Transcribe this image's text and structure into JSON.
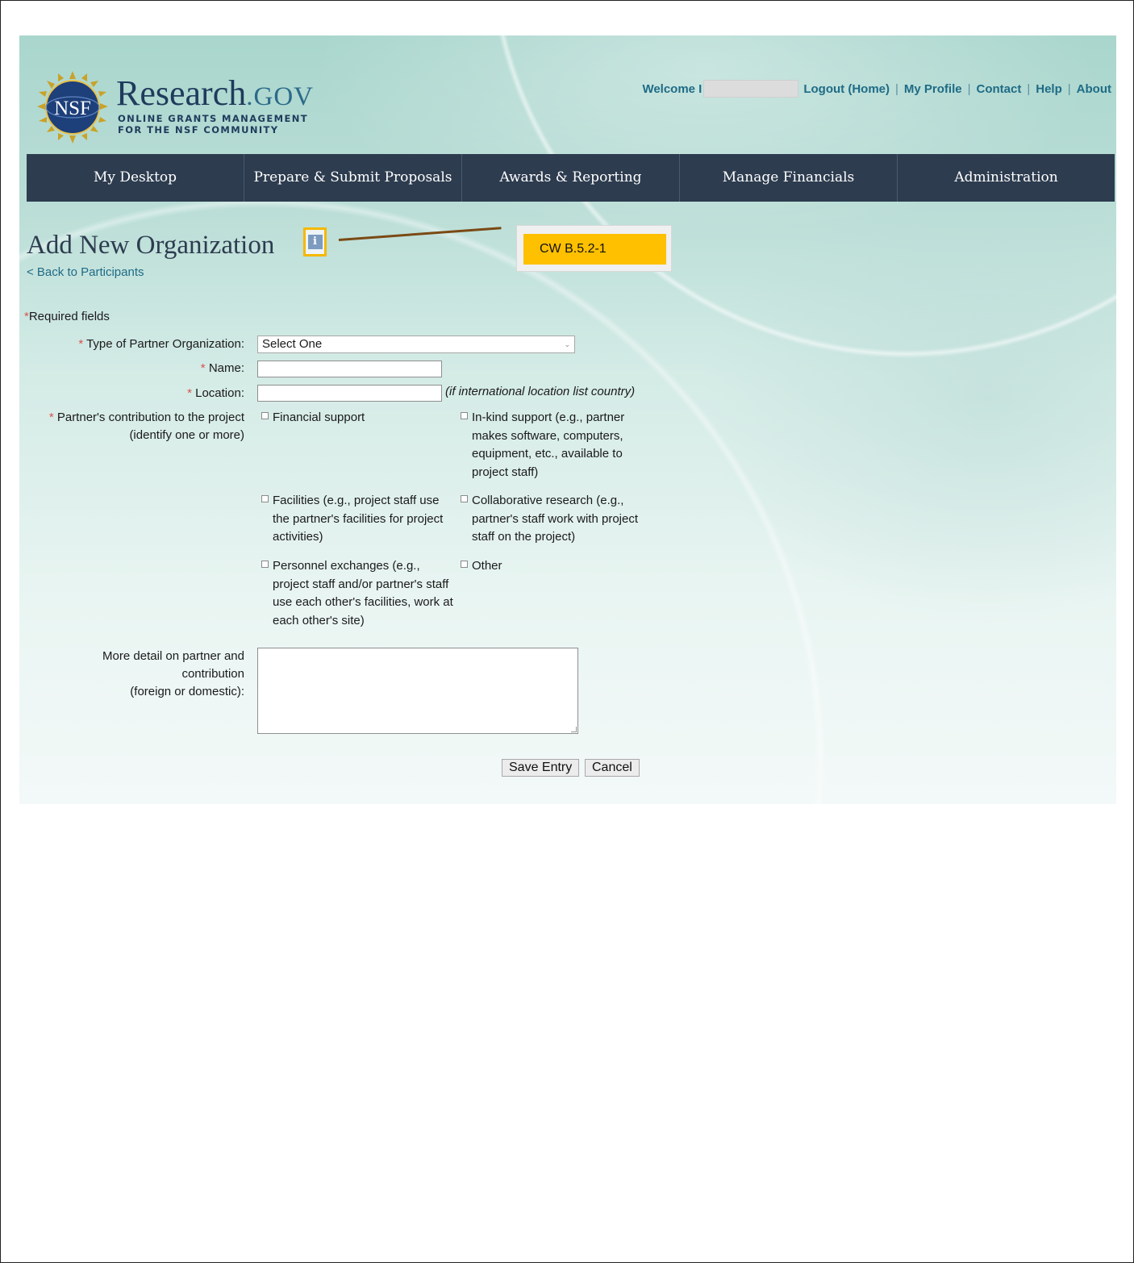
{
  "header": {
    "brand_main": "Research",
    "brand_tld": ".GOV",
    "brand_sub_line1": "ONLINE GRANTS MANAGEMENT",
    "brand_sub_line2": "FOR THE NSF COMMUNITY",
    "seal_text": "NSF",
    "welcome": "Welcome I",
    "links": {
      "logout": "Logout (Home)",
      "profile": "My Profile",
      "contact": "Contact",
      "help": "Help",
      "about": "About"
    }
  },
  "nav": {
    "items": [
      {
        "label": "My Desktop"
      },
      {
        "label": "Prepare & Submit Proposals"
      },
      {
        "label": "Awards & Reporting"
      },
      {
        "label": "Manage Financials"
      },
      {
        "label": "Administration"
      }
    ]
  },
  "page": {
    "title": "Add New Organization",
    "info_icon": "i",
    "callout": "CW B.5.2-1",
    "back_link": "< Back to Participants",
    "required_marker": "*",
    "required_note": "Required fields"
  },
  "form": {
    "type_label": "Type of Partner Organization:",
    "type_value": "Select One",
    "name_label": "Name:",
    "name_value": "",
    "location_label": "Location:",
    "location_value": "",
    "location_hint": "(if international location list country)",
    "contribution_label_line1": "Partner's contribution to the project",
    "contribution_label_line2": "(identify one or more)",
    "options": {
      "financial": "Financial support",
      "inkind": "In-kind support (e.g., partner makes software, computers, equipment, etc., available to project staff)",
      "facilities": "Facilities (e.g., project staff use the partner's facilities for project activities)",
      "collab": "Collaborative research (e.g., partner's staff work with project staff on the project)",
      "personnel": "Personnel exchanges (e.g., project staff and/or partner's staff use each other's facilities, work at each other's site)",
      "other": "Other"
    },
    "detail_label_line1": "More detail on partner and",
    "detail_label_line2": "contribution",
    "detail_label_line3": "(foreign or domestic):",
    "detail_value": "",
    "save_label": "Save Entry",
    "cancel_label": "Cancel"
  },
  "colors": {
    "nav_bg": "#2d3c4f",
    "link": "#1e6b86",
    "required": "#d9534f",
    "callout": "#ffc000",
    "callout_line": "#7a4a14"
  }
}
